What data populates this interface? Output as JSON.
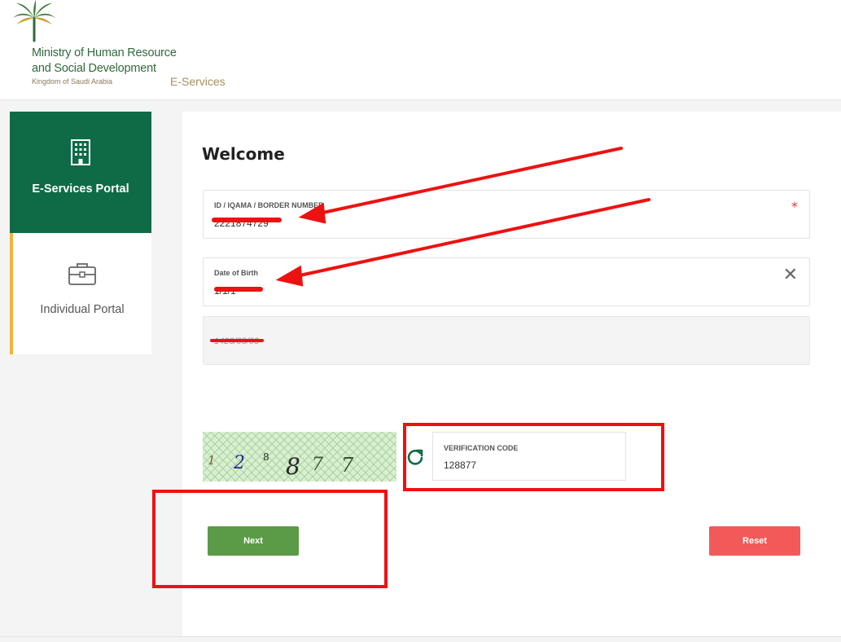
{
  "header": {
    "ministry_line1": "Ministry of Human Resource",
    "ministry_line2": "and Social Development",
    "kingdom": "Kingdom of Saudi Arabia",
    "eservices": "E-Services"
  },
  "sidebar": {
    "items": [
      {
        "label": "E-Services Portal",
        "icon": "building-icon",
        "active": true
      },
      {
        "label": "Individual Portal",
        "icon": "briefcase-icon",
        "active": false
      }
    ]
  },
  "form": {
    "title": "Welcome",
    "id_field": {
      "label": "ID / IQAMA / BORDER NUMBER",
      "value": "2221874729",
      "required_mark": "*"
    },
    "dob_field": {
      "label": "Date of Birth",
      "value": "1/1/1"
    },
    "hijri_field": {
      "value": "1423/03/03"
    },
    "captcha": {
      "digits": [
        "1",
        "2",
        "8",
        "8",
        "7",
        "7"
      ]
    },
    "verification": {
      "label": "VERIFICATION CODE",
      "value": "128877"
    },
    "next_label": "Next",
    "reset_label": "Reset"
  },
  "colors": {
    "brand_green": "#0e6b45",
    "next_green": "#5b9a47",
    "reset_red": "#f25a5a",
    "annotation_red": "#ee1111",
    "accent_gold": "#f0b43c"
  }
}
